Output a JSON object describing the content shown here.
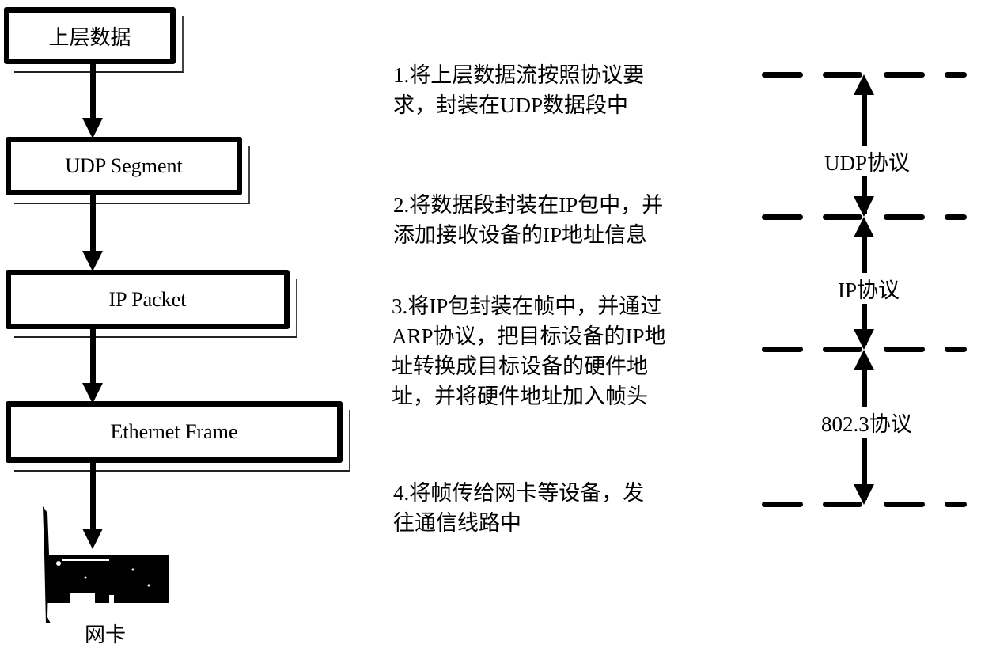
{
  "left_stack": {
    "boxes": [
      {
        "label": "上层数据"
      },
      {
        "label": "UDP Segment"
      },
      {
        "label": "IP Packet"
      },
      {
        "label": "Ethernet Frame"
      }
    ],
    "device": {
      "icon": "network-card-icon",
      "caption": "网卡"
    }
  },
  "steps": [
    {
      "lines": [
        "1.将上层数据流按照协议要",
        "求，封装在UDP数据段中"
      ]
    },
    {
      "lines": [
        "2.将数据段封装在IP包中，并",
        "添加接收设备的IP地址信息"
      ]
    },
    {
      "lines": [
        "3.将IP包封装在帧中，并通过",
        "ARP协议，把目标设备的IP地",
        "址转换成目标设备的硬件地",
        "址，并将硬件地址加入帧头"
      ]
    },
    {
      "lines": [
        "4.将帧传给网卡等设备，发",
        "往通信线路中"
      ]
    }
  ],
  "protocols": [
    {
      "label": "UDP协议"
    },
    {
      "label": "IP协议"
    },
    {
      "label": "802.3协议"
    }
  ]
}
